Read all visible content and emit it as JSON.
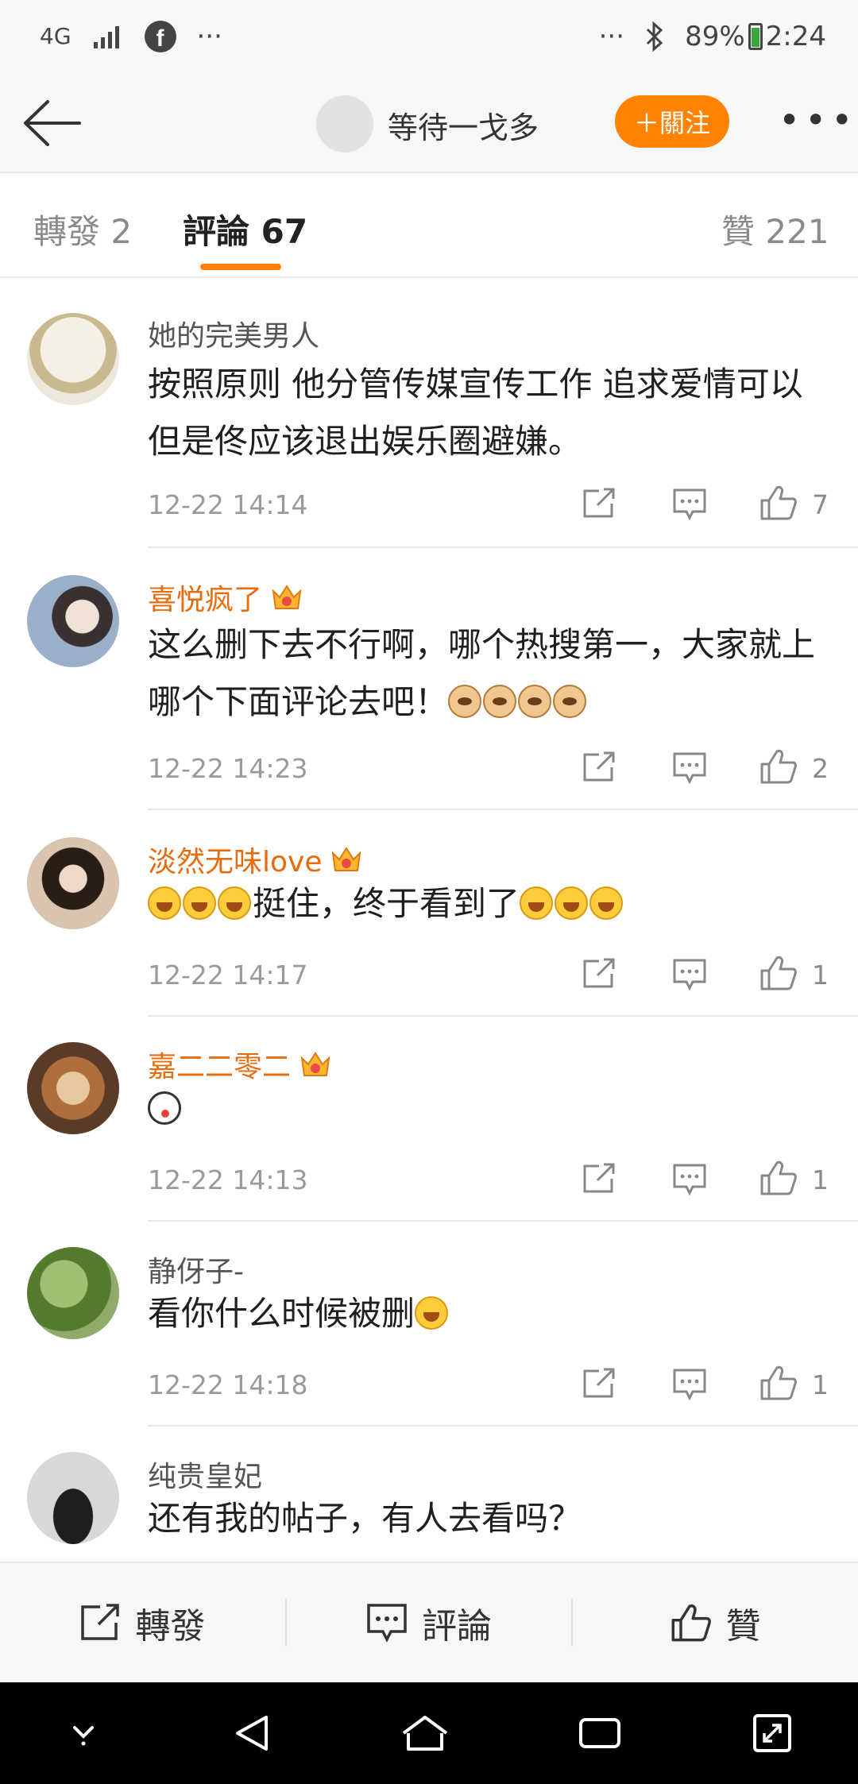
{
  "status_bar": {
    "network": "4G",
    "left_more": "···",
    "right_more": "···",
    "battery": "89%",
    "time": "2:24"
  },
  "header": {
    "username": "等待一戈多",
    "follow_label": "＋關注"
  },
  "tabs": [
    {
      "label": "轉發 2"
    },
    {
      "label": "評論 67"
    },
    {
      "label": "贊 221"
    }
  ],
  "comments": [
    {
      "name": "她的完美男人",
      "vip": false,
      "text": "按照原则 他分管传媒宣传工作 追求爱情可以 但是佟应该退出娱乐圈避嫌。",
      "time": "12-22 14:14",
      "likes": "7"
    },
    {
      "name": "喜悦疯了",
      "vip": true,
      "text": "这么删下去不行啊，哪个热搜第一，大家就上哪个下面评论去吧！",
      "time": "12-22 14:23",
      "likes": "2"
    },
    {
      "name": "淡然无味love",
      "vip": true,
      "text_mid": "挺住，终于看到了",
      "time": "12-22 14:17",
      "likes": "1"
    },
    {
      "name": "嘉二二零二",
      "vip": true,
      "text": "",
      "time": "12-22 14:13",
      "likes": "1"
    },
    {
      "name": "静伢子-",
      "vip": false,
      "text": "看你什么时候被删",
      "time": "12-22 14:18",
      "likes": "1"
    },
    {
      "name": "纯贵皇妃",
      "vip": false,
      "text": "还有我的帖子，有人去看吗？",
      "time": "",
      "likes": ""
    }
  ],
  "bottom_bar": {
    "repost_label": "轉發",
    "comment_label": "評論",
    "like_label": "贊"
  },
  "colors": {
    "accent": "#ff8200",
    "vip_name": "#e86b0c"
  }
}
